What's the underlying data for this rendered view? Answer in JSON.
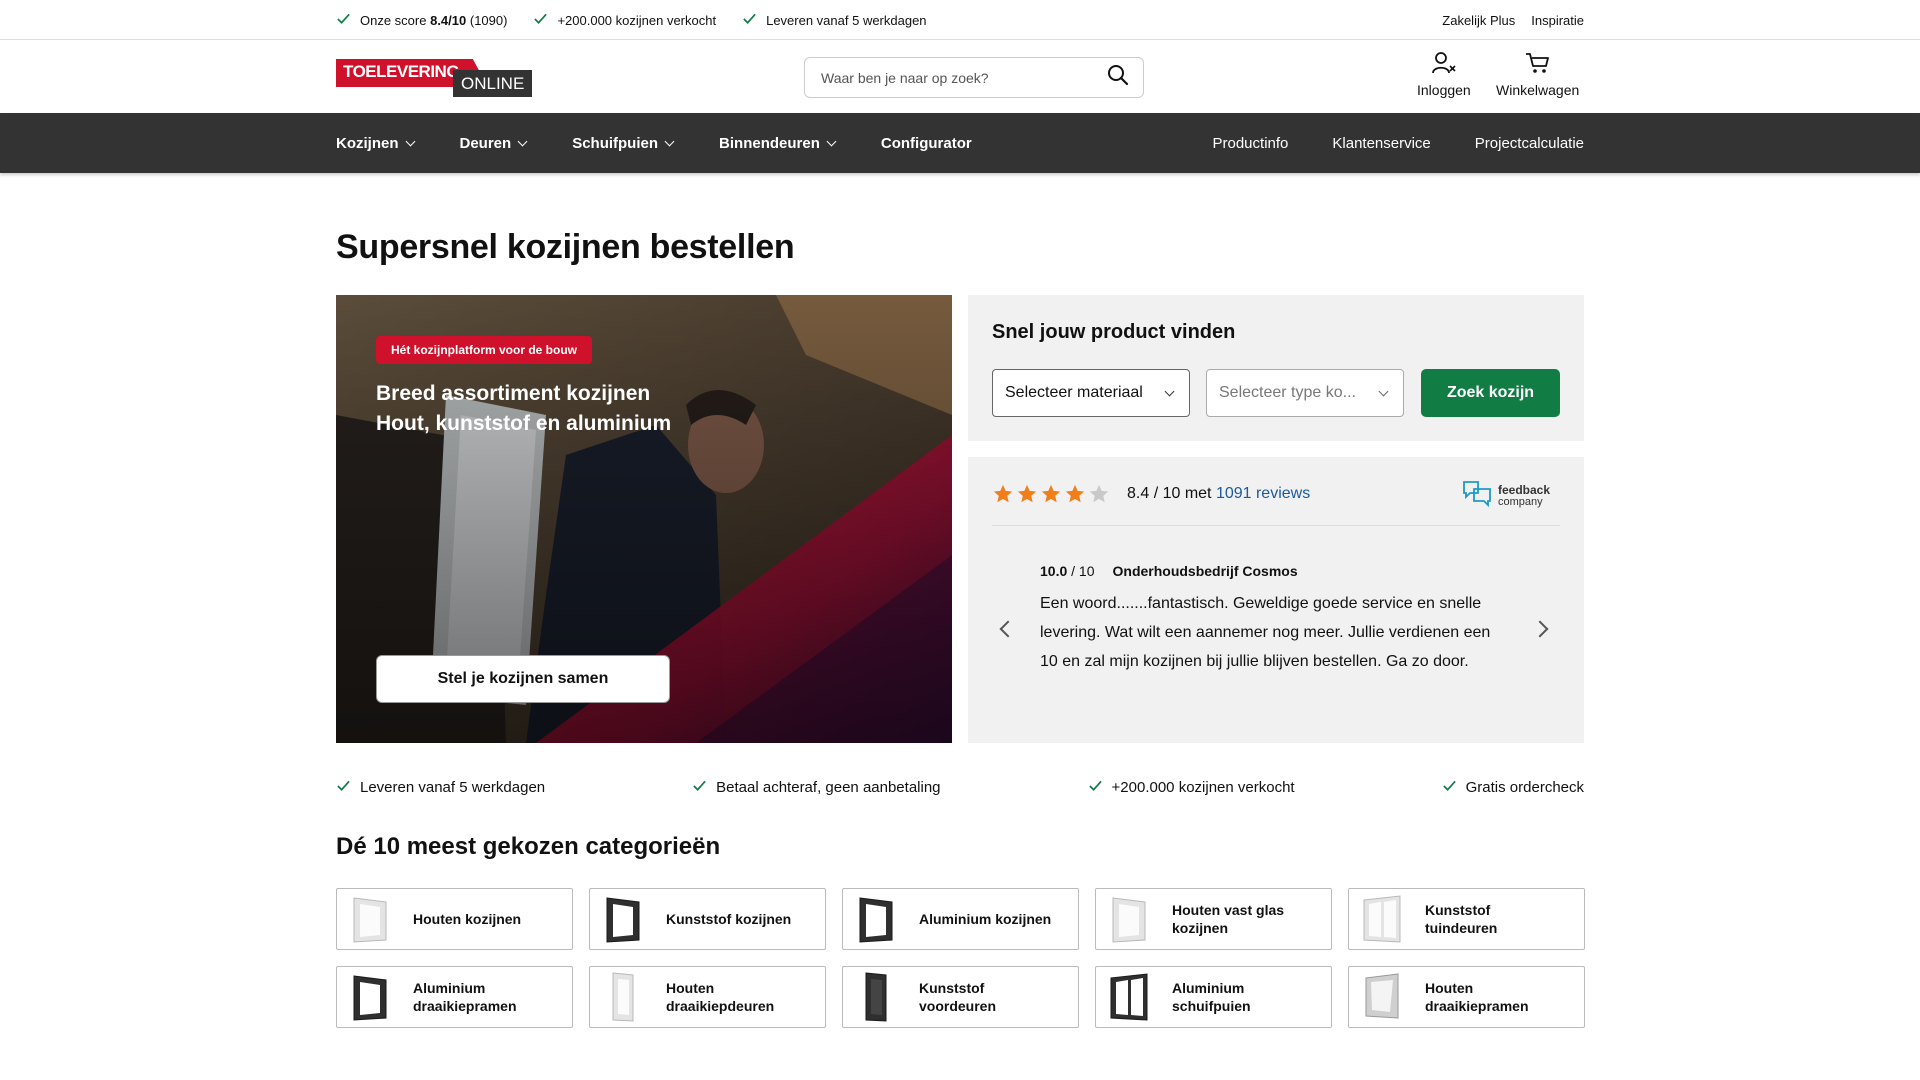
{
  "usp_bar": {
    "items": [
      {
        "pre": "Onze score ",
        "bold": "8.4/10",
        "post": " (1090)"
      },
      {
        "pre": "+200.000 kozijnen verkocht",
        "bold": "",
        "post": ""
      },
      {
        "pre": "Leveren vanaf 5 werkdagen",
        "bold": "",
        "post": ""
      }
    ],
    "links": [
      "Zakelijk Plus",
      "Inspiratie"
    ]
  },
  "header": {
    "logo_top": "TOELEVERING",
    "logo_bottom": "ONLINE",
    "search_placeholder": "Waar ben je naar op zoek?",
    "login_label": "Inloggen",
    "cart_label": "Winkelwagen"
  },
  "nav": {
    "left": [
      "Kozijnen",
      "Deuren",
      "Schuifpuien",
      "Binnendeuren",
      "Configurator"
    ],
    "right": [
      "Productinfo",
      "Klantenservice",
      "Projectcalculatie"
    ]
  },
  "page_title": "Supersnel kozijnen bestellen",
  "hero": {
    "badge": "Hét kozijnplatform voor de bouw",
    "title_line1": "Breed assortiment kozijnen",
    "title_line2": "Hout, kunststof en aluminium",
    "cta": "Stel je kozijnen samen"
  },
  "finder": {
    "title": "Snel jouw product vinden",
    "material": "Selecteer materiaal",
    "type": "Selecteer type ko...",
    "button": "Zoek kozijn"
  },
  "reviews": {
    "stars": 4,
    "score_text": "8.4 / 10 met ",
    "reviews_link": "1091 reviews",
    "brand_line1": "feedback",
    "brand_line2": "company",
    "review_score": "10.0",
    "review_scale": " / 10",
    "review_author": "Onderhoudsbedrijf Cosmos",
    "review_text": "Een woord.......fantastisch. Geweldige goede service en snelle levering. Wat wilt een aannemer nog meer. Jullie verdienen een 10 en zal mijn kozijnen bij jullie blijven bestellen. Ga zo door."
  },
  "usps": [
    "Leveren vanaf 5 werkdagen",
    "Betaal achteraf, geen aanbetaling",
    "+200.000 kozijnen verkocht",
    "Gratis ordercheck"
  ],
  "categories_title": "Dé 10 meest gekozen categorieën",
  "categories": [
    {
      "label": "Houten kozijnen",
      "icon": "white-frame"
    },
    {
      "label": "Kunststof kozijnen",
      "icon": "dark-frame-white"
    },
    {
      "label": "Aluminium kozijnen",
      "icon": "dark-frame"
    },
    {
      "label": "Houten vast glas kozijnen",
      "icon": "white-frame"
    },
    {
      "label": "Kunststof tuindeuren",
      "icon": "white-double"
    },
    {
      "label": "Aluminium draaikiepramen",
      "icon": "dark-frame"
    },
    {
      "label": "Houten draaikiepdeuren",
      "icon": "white-door"
    },
    {
      "label": "Kunststof voordeuren",
      "icon": "dark-door"
    },
    {
      "label": "Aluminium schuifpuien",
      "icon": "dark-double"
    },
    {
      "label": "Houten draaikiepramen",
      "icon": "white-tilt"
    }
  ],
  "colors": {
    "brand_red": "#d0112b",
    "nav_bg": "#333333",
    "cta_green": "#127c45",
    "check_green": "#127c45",
    "star_orange": "#f07f1b"
  }
}
